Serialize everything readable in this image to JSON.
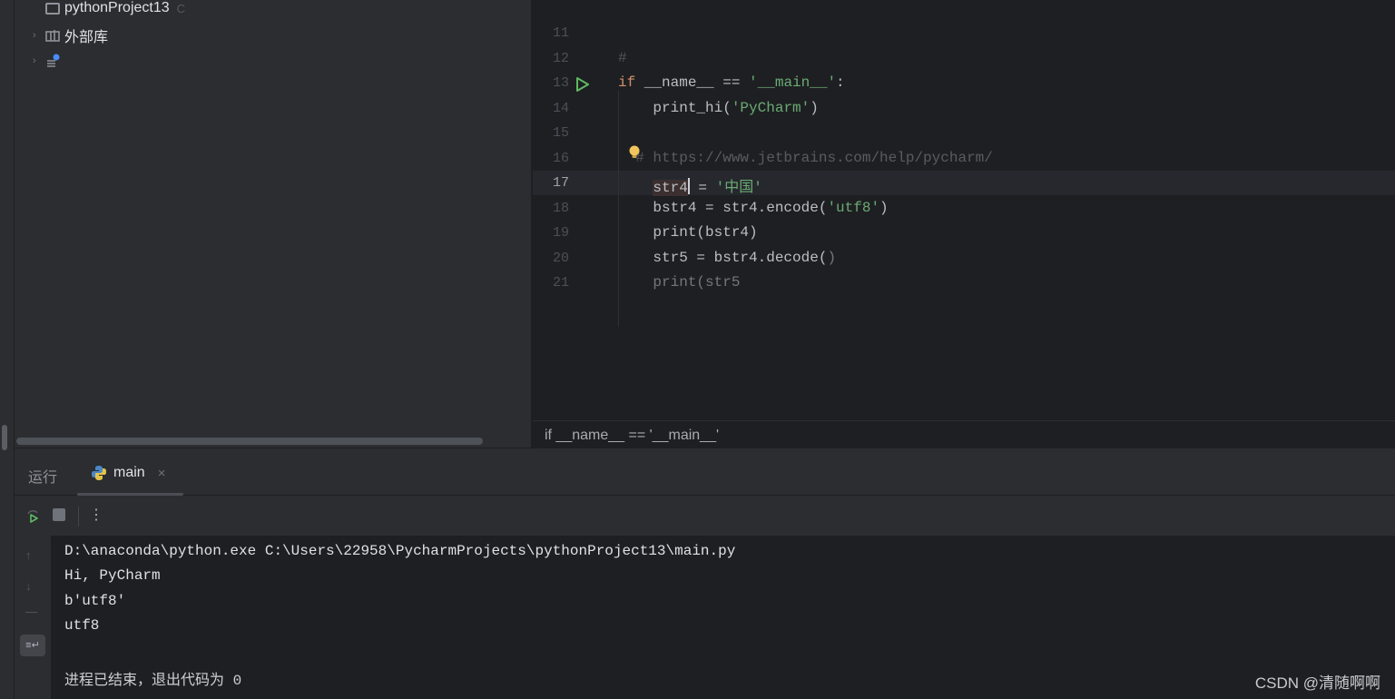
{
  "project_panel": {
    "items": [
      {
        "label": "pythonProject13",
        "hint": "C"
      },
      {
        "label": "外部库",
        "hint": ""
      },
      {
        "label": "",
        "hint": ""
      }
    ]
  },
  "editor": {
    "line_numbers": [
      "11",
      "12",
      "13",
      "14",
      "15",
      "16",
      "17",
      "18",
      "19",
      "20",
      "21"
    ],
    "active_line": "17",
    "lines": [
      {
        "segments": []
      },
      {
        "segments": [
          {
            "t": "#",
            "c": "dim faded"
          }
        ]
      },
      {
        "segments": [
          {
            "t": "if",
            "c": "kw"
          },
          {
            "t": " __name__ == ",
            "c": ""
          },
          {
            "t": "'__main__'",
            "c": "str"
          },
          {
            "t": ":",
            "c": ""
          }
        ]
      },
      {
        "segments": [
          {
            "t": "    print_hi(",
            "c": ""
          },
          {
            "t": "'PyCharm'",
            "c": "str"
          },
          {
            "t": ")",
            "c": ""
          }
        ]
      },
      {
        "segments": []
      },
      {
        "segments": [
          {
            "t": "  # ",
            "c": "dim faded"
          },
          {
            "t": "https://www.jetbrains.com/help/pycharm/",
            "c": "link faded"
          }
        ]
      },
      {
        "segments": [
          {
            "t": "    ",
            "c": ""
          },
          {
            "t": "str4",
            "c": "sel"
          },
          {
            "t": " = ",
            "c": ""
          },
          {
            "t": "'中国'",
            "c": "str"
          }
        ]
      },
      {
        "segments": [
          {
            "t": "    bstr4 = str4.encode(",
            "c": ""
          },
          {
            "t": "'utf8'",
            "c": "str"
          },
          {
            "t": ")",
            "c": ""
          }
        ]
      },
      {
        "segments": [
          {
            "t": "    print(bstr4)",
            "c": ""
          }
        ]
      },
      {
        "segments": [
          {
            "t": "    str5 = bstr4.decode(",
            "c": ""
          },
          {
            "t": ")",
            "c": "faded"
          }
        ]
      },
      {
        "segments": [
          {
            "t": "    print(str5",
            "c": "faded"
          }
        ]
      }
    ]
  },
  "breadcrumb": "if __name__ == '__main__'",
  "run_window": {
    "tab_label": "运行",
    "config_tab": "main",
    "console_lines": [
      "D:\\anaconda\\python.exe C:\\Users\\22958\\PycharmProjects\\pythonProject13\\main.py",
      "Hi, PyCharm",
      "b'utf8'",
      "utf8",
      "",
      "进程已结束，退出代码为 0"
    ]
  },
  "watermark": "CSDN @清随啊啊",
  "colors": {
    "keyword": "#cf8e6d",
    "string": "#6aab73",
    "run_green": "#5fb865",
    "bulb_yellow": "#f2c55c"
  }
}
